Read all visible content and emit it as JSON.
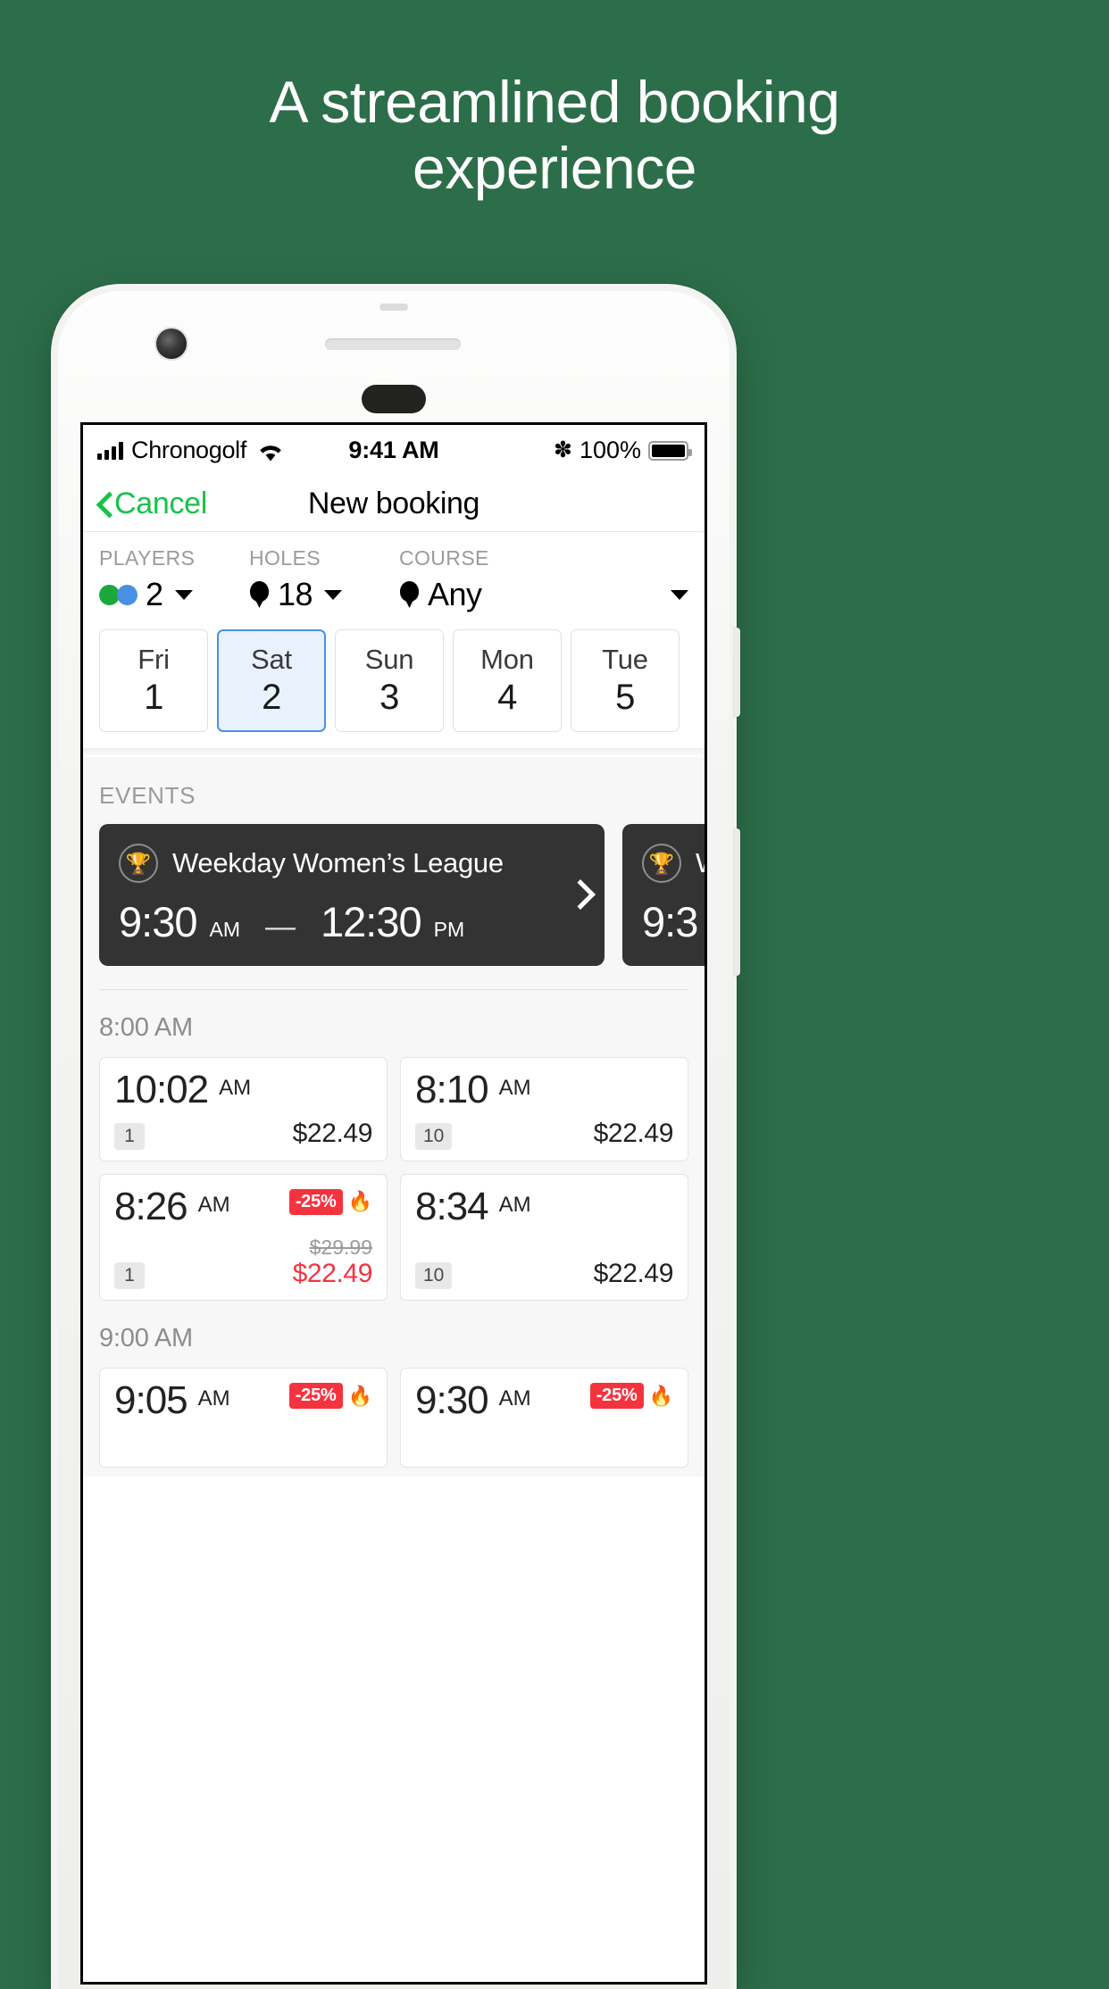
{
  "headline": "A streamlined booking experience",
  "theme": {
    "background": "#2c6e49",
    "accent_green": "#17c24a",
    "select_blue": "#4a90e2",
    "sale_red": "#f5333f"
  },
  "status_bar": {
    "carrier": "Chronogolf",
    "signal_icon": "signal-bars-icon",
    "wifi_icon": "wifi-icon",
    "time": "9:41 AM",
    "bluetooth_icon": "bluetooth-icon",
    "battery_percent": "100%",
    "battery_icon": "battery-full-icon"
  },
  "nav": {
    "back_icon": "chevron-left-icon",
    "cancel_label": "Cancel",
    "title": "New booking"
  },
  "filters": [
    {
      "label": "PLAYERS",
      "value": "2",
      "icon": "player-dots-icon",
      "dot_colors": [
        "#19a83c",
        "#4a90e2"
      ],
      "caret_icon": "caret-down-icon"
    },
    {
      "label": "HOLES",
      "value": "18",
      "icon": "golf-tee-icon",
      "caret_icon": "caret-down-icon"
    },
    {
      "label": "COURSE",
      "value": "Any",
      "icon": "golf-tee-icon",
      "caret_icon": "caret-down-icon"
    }
  ],
  "dates": [
    {
      "dow": "Fri",
      "day": "1",
      "selected": false
    },
    {
      "dow": "Sat",
      "day": "2",
      "selected": true
    },
    {
      "dow": "Sun",
      "day": "3",
      "selected": false
    },
    {
      "dow": "Mon",
      "day": "4",
      "selected": false
    },
    {
      "dow": "Tue",
      "day": "5",
      "selected": false
    }
  ],
  "events_section": {
    "label": "EVENTS",
    "cards": [
      {
        "icon": "trophy-icon",
        "title": "Weekday Women’s League",
        "start_time": "9:30",
        "start_meridiem": "AM",
        "dash": "—",
        "end_time": "12:30",
        "end_meridiem": "PM",
        "arrow_icon": "chevron-right-icon"
      },
      {
        "icon": "trophy-icon",
        "title": "W",
        "start_time": "9:3",
        "start_meridiem": "",
        "dash": "",
        "end_time": "",
        "end_meridiem": "",
        "arrow_icon": "chevron-right-icon"
      }
    ]
  },
  "tee_time_groups": [
    {
      "label": "8:00 AM",
      "slots": [
        {
          "time": "10:02",
          "meridiem": "AM",
          "players_badge": "1",
          "price": "$22.49",
          "old_price": null,
          "discount": null,
          "flame_icon": null
        },
        {
          "time": "8:10",
          "meridiem": "AM",
          "players_badge": "10",
          "price": "$22.49",
          "old_price": null,
          "discount": null,
          "flame_icon": null
        },
        {
          "time": "8:26",
          "meridiem": "AM",
          "players_badge": "1",
          "price": "$22.49",
          "old_price": "$29.99",
          "discount": "-25%",
          "flame_icon": "flame-icon"
        },
        {
          "time": "8:34",
          "meridiem": "AM",
          "players_badge": "10",
          "price": "$22.49",
          "old_price": null,
          "discount": null,
          "flame_icon": null
        }
      ]
    },
    {
      "label": "9:00 AM",
      "slots": [
        {
          "time": "9:05",
          "meridiem": "AM",
          "players_badge": "",
          "price": "",
          "old_price": null,
          "discount": "-25%",
          "flame_icon": "flame-icon"
        },
        {
          "time": "9:30",
          "meridiem": "AM",
          "players_badge": "",
          "price": "",
          "old_price": null,
          "discount": "-25%",
          "flame_icon": "flame-icon"
        }
      ]
    }
  ]
}
